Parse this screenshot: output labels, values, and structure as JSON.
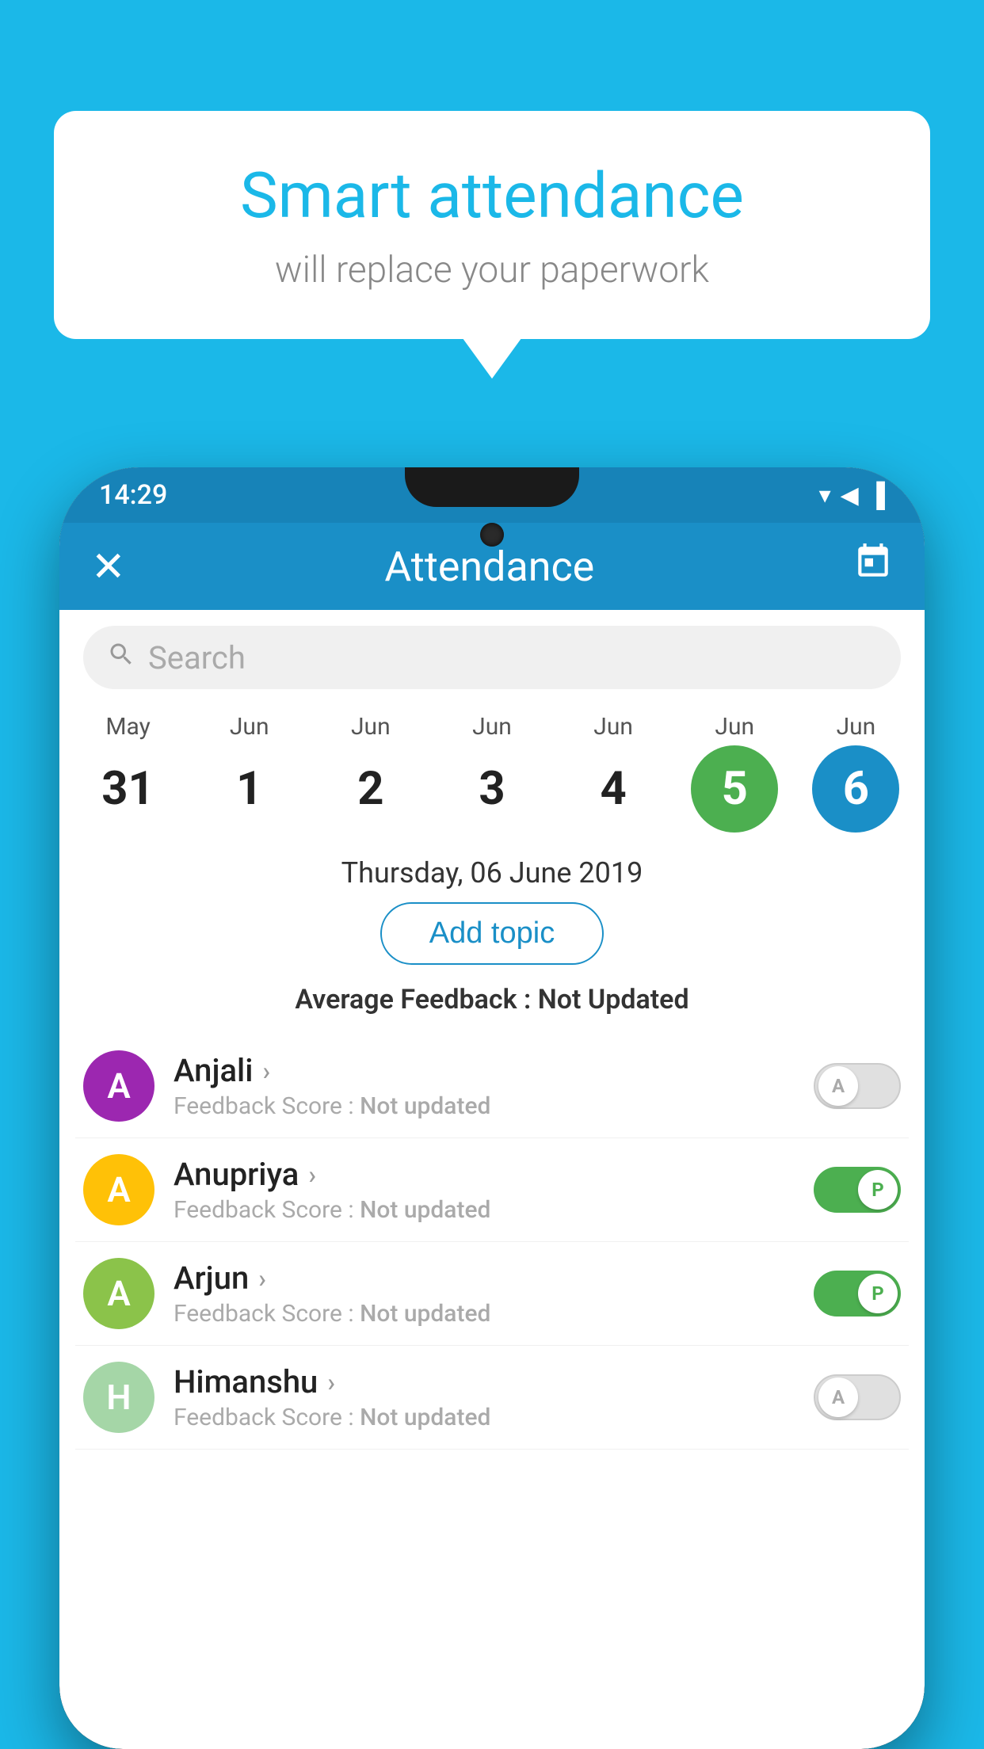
{
  "background_color": "#1bb8e8",
  "bubble": {
    "title": "Smart attendance",
    "subtitle": "will replace your paperwork"
  },
  "status_bar": {
    "time": "14:29",
    "wifi": "▼",
    "signal": "▲",
    "battery": "▐"
  },
  "app_bar": {
    "close_label": "✕",
    "title": "Attendance",
    "calendar_label": "📅"
  },
  "search": {
    "placeholder": "Search"
  },
  "calendar": {
    "dates": [
      {
        "month": "May",
        "day": "31",
        "state": "normal"
      },
      {
        "month": "Jun",
        "day": "1",
        "state": "normal"
      },
      {
        "month": "Jun",
        "day": "2",
        "state": "normal"
      },
      {
        "month": "Jun",
        "day": "3",
        "state": "normal"
      },
      {
        "month": "Jun",
        "day": "4",
        "state": "normal"
      },
      {
        "month": "Jun",
        "day": "5",
        "state": "today"
      },
      {
        "month": "Jun",
        "day": "6",
        "state": "selected"
      }
    ]
  },
  "selected_date_label": "Thursday, 06 June 2019",
  "add_topic_label": "Add topic",
  "avg_feedback": {
    "label": "Average Feedback : ",
    "value": "Not Updated"
  },
  "students": [
    {
      "name": "Anjali",
      "avatar_letter": "A",
      "avatar_color": "#9c27b0",
      "feedback_label": "Feedback Score : ",
      "feedback_value": "Not updated",
      "toggle_state": "off",
      "toggle_letter": "A"
    },
    {
      "name": "Anupriya",
      "avatar_letter": "A",
      "avatar_color": "#ffc107",
      "feedback_label": "Feedback Score : ",
      "feedback_value": "Not updated",
      "toggle_state": "on",
      "toggle_letter": "P"
    },
    {
      "name": "Arjun",
      "avatar_letter": "A",
      "avatar_color": "#8bc34a",
      "feedback_label": "Feedback Score : ",
      "feedback_value": "Not updated",
      "toggle_state": "on",
      "toggle_letter": "P"
    },
    {
      "name": "Himanshu",
      "avatar_letter": "H",
      "avatar_color": "#a5d6a7",
      "feedback_label": "Feedback Score : ",
      "feedback_value": "Not updated",
      "toggle_state": "off",
      "toggle_letter": "A"
    }
  ]
}
